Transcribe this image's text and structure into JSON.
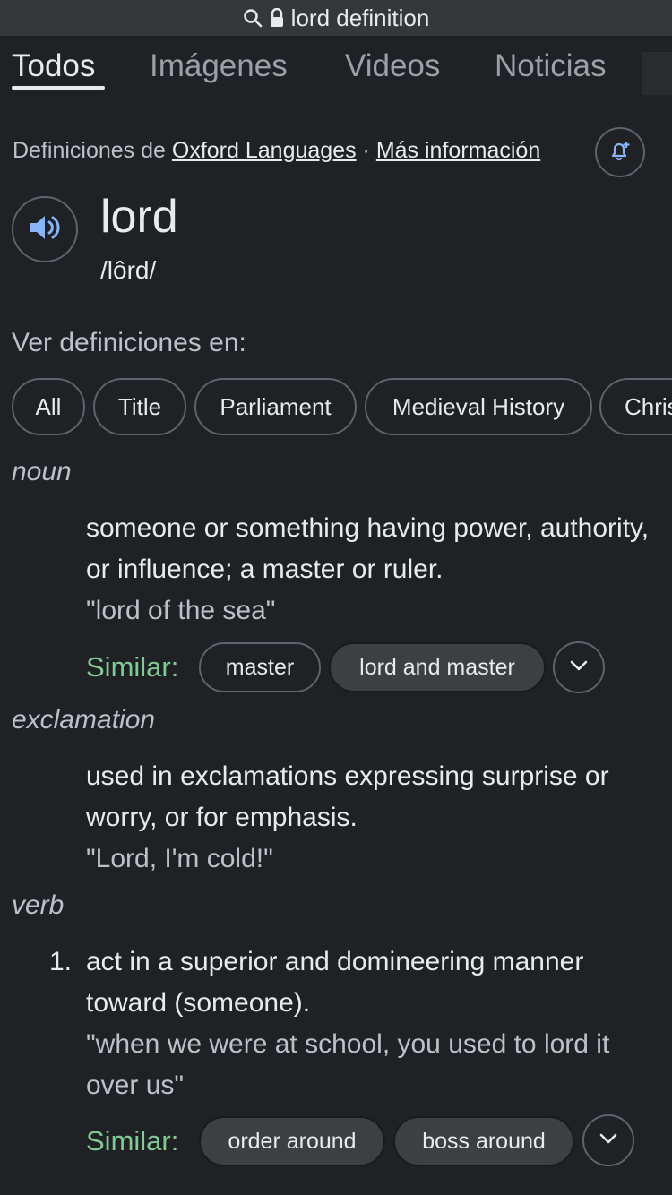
{
  "url_bar": {
    "query": "lord definition",
    "icons": [
      "search-icon",
      "lock-icon"
    ]
  },
  "tabs": [
    {
      "label": "Todos",
      "active": true
    },
    {
      "label": "Imágenes",
      "active": false
    },
    {
      "label": "Videos",
      "active": false
    },
    {
      "label": "Noticias",
      "active": false
    }
  ],
  "source": {
    "prefix": "Definiciones de",
    "provider": "Oxford Languages",
    "separator": "·",
    "more_info": "Más información"
  },
  "entry": {
    "word": "lord",
    "phonetic": "/lôrd/"
  },
  "see_definitions": {
    "label": "Ver definiciones en:",
    "chips": [
      "All",
      "Title",
      "Parliament",
      "Medieval History",
      "Chris"
    ]
  },
  "senses": [
    {
      "pos": "noun",
      "definition": "someone or something having power, authority, or influence; a master or ruler.",
      "example": "\"lord of the sea\"",
      "similar_label": "Similar:",
      "similar": [
        "master",
        "lord and master"
      ]
    },
    {
      "pos": "exclamation",
      "definition": "used in exclamations expressing surprise or worry, or for emphasis.",
      "example": "\"Lord, I'm cold!\""
    },
    {
      "pos": "verb",
      "number": "1.",
      "definition": "act in a superior and domineering manner toward (someone).",
      "example": "\"when we were at school, you used to lord it over us\"",
      "similar_label": "Similar:",
      "similar": [
        "order around",
        "boss around"
      ]
    }
  ],
  "colors": {
    "background": "#202124",
    "text": "#e8eaed",
    "muted": "#bdc1c6",
    "similar_green": "#81c995",
    "speaker_blue": "#8ab4f8",
    "border": "#5f6368"
  }
}
